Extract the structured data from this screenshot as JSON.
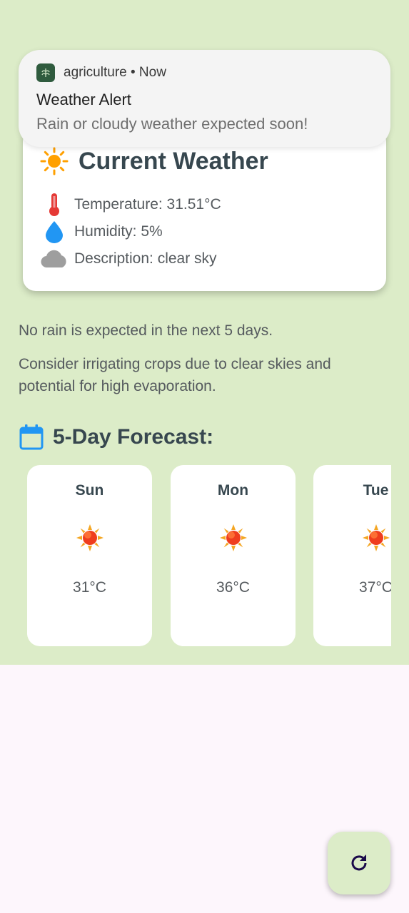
{
  "notification": {
    "app_name": "agriculture",
    "time": " • Now",
    "title": "Weather Alert",
    "body": "Rain or cloudy weather expected soon!",
    "app_icon": "agriculture-app-icon"
  },
  "current_weather": {
    "title": "Current Weather",
    "title_icon": "sun-icon",
    "temperature": "Temperature: 31.51°C",
    "humidity": "Humidity: 5%",
    "description": "Description: clear sky"
  },
  "messages": {
    "rain": "No rain is expected in the next 5 days.",
    "advice": "Consider irrigating crops due to clear skies and potential for high evaporation."
  },
  "forecast": {
    "title": "5-Day Forecast:",
    "days": [
      {
        "day": "Sun",
        "temp": "31°C",
        "icon": "sun-icon"
      },
      {
        "day": "Mon",
        "temp": "36°C",
        "icon": "sun-icon"
      },
      {
        "day": "Tue",
        "temp": "37°C",
        "icon": "sun-icon"
      }
    ]
  },
  "fab": {
    "icon": "refresh-icon"
  },
  "colors": {
    "background": "#dcecc8",
    "heading": "#37474f",
    "body_text": "#555a5e",
    "sun": "#ffa000",
    "thermometer": "#e53935",
    "humidity": "#2196f3",
    "calendar": "#2196f3",
    "cloud": "#9e9e9e",
    "fab_icon": "#1b0a4a"
  }
}
